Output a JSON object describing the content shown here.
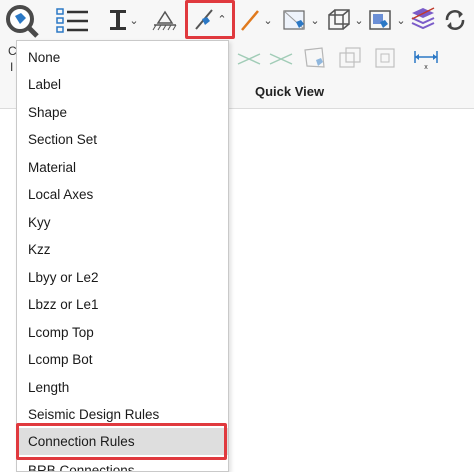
{
  "ribbon": {
    "group_label": "Quick View",
    "edge_text_1": "C",
    "edge_text_2": "I"
  },
  "colors": {
    "highlight": "#e0393e",
    "accent_blue": "#2b78c5",
    "accent_orange": "#e07a1e",
    "accent_purple": "#7b5cc9"
  },
  "menu": {
    "items": [
      {
        "label": "None"
      },
      {
        "label": "Label"
      },
      {
        "label": "Shape"
      },
      {
        "label": "Section Set"
      },
      {
        "label": "Material"
      },
      {
        "label": "Local Axes"
      },
      {
        "label": "Kyy"
      },
      {
        "label": "Kzz"
      },
      {
        "label": "Lbyy or Le2"
      },
      {
        "label": "Lbzz or Le1"
      },
      {
        "label": "Lcomp Top"
      },
      {
        "label": "Lcomp Bot"
      },
      {
        "label": "Length"
      },
      {
        "label": "Seismic Design Rules"
      },
      {
        "label": "Connection Rules"
      },
      {
        "label": "BRB Connections"
      }
    ],
    "selected": "Connection Rules"
  }
}
